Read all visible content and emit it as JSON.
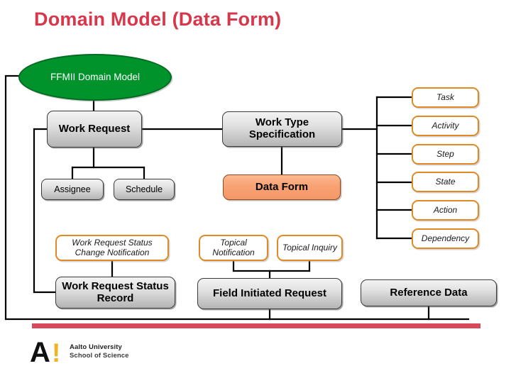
{
  "slide": {
    "title": "Domain Model (Data Form)",
    "root": {
      "label": "FFMII Domain Model",
      "shape": "ellipse",
      "color": "#00922B"
    },
    "nodes": {
      "work_request": "Work Request",
      "work_type_specification": "Work Type Specification",
      "assignee": "Assignee",
      "schedule": "Schedule",
      "data_form": "Data Form",
      "work_request_status_change_notification": "Work Request Status Change Notification",
      "work_request_status_record": "Work Request Status Record",
      "topical_notification": "Topical Notification",
      "topical_inquiry": "Topical Inquiry",
      "field_initiated_request": "Field Initiated Request",
      "reference_data": "Reference Data"
    },
    "work_type_children": [
      "Task",
      "Activity",
      "Step",
      "State",
      "Action",
      "Dependency"
    ],
    "colors": {
      "title": "#D8374B",
      "root_fill": "#00922B",
      "entity_outline": "#E08A27",
      "highlight_fill": "#F8A273",
      "accent_bar": "#D8495B",
      "logo_accent": "#F0B323"
    },
    "footer": {
      "logo_letter": "A",
      "logo_bang": "!",
      "org_line1": "Aalto University",
      "org_line2": "School of Science"
    }
  }
}
